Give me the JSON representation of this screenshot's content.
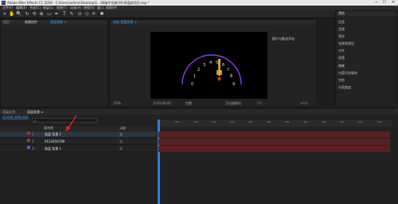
{
  "window": {
    "app_icon": "Ae",
    "title": "Adobe After Effects CC 2018 - C:\\Users\\admin\\Desktop\\1、AE破坏切换(四)\\表盘新项目.aep *",
    "minimize": "—",
    "maximize": "☐",
    "close": "✕"
  },
  "menu": [
    "文件(F)",
    "编辑(E)",
    "合成(C)",
    "图层(L)",
    "效果(T)",
    "动画(A)",
    "视图(V)",
    "窗口",
    "帮助(H)"
  ],
  "toolbar": {
    "tools": [
      "selection-arrow",
      "hand",
      "zoom",
      "rotate",
      "orbit-camera",
      "pan-behind",
      "rectangle-mask",
      "pen",
      "text",
      "brush",
      "clone-stamp",
      "eraser",
      "roto-brush",
      "puppet-pin"
    ],
    "glyphs": [
      "➤",
      "✋",
      "🔍",
      "↻",
      "⟲",
      "⊕",
      "▭",
      "✒",
      "T",
      "✎",
      "⊙",
      "◇",
      "✍",
      "✱"
    ]
  },
  "left_panel": {
    "tab_project": "项目",
    "tab_effects": "效果控件",
    "tab_layer": "表盘背景 ≡"
  },
  "comp_panel": {
    "tab": "合成 表盘背景 ≡",
    "tab_color": "#4aa3ff"
  },
  "viewer": {
    "numbers": [
      "0",
      "1",
      "2",
      "3",
      "4",
      "5",
      "6",
      "7",
      "8",
      "9"
    ],
    "arc_color": "#8c3cff",
    "needle_color": "#e6b23c",
    "label": "图片与推送开启"
  },
  "viewer_footer": {
    "zoom": "25%",
    "timecode": "0;00;00;00",
    "resolution": "完整",
    "camera": "活动摄像机",
    "views": "1个...",
    "exposure": "+0.0"
  },
  "right_panel": {
    "title": "预览",
    "items": [
      "信息",
      "音频",
      "预览",
      "效果和预设",
      "对齐",
      "段落"
    ],
    "lower_title": "效果",
    "sub_items": [
      "内容识别填充",
      "字符",
      "分离维度"
    ]
  },
  "timeline": {
    "tab_render": "渲染队列",
    "tab_comp": "表盘背景 ≡",
    "timecode": "0;00;00;00",
    "search_placeholder": "ρ",
    "columns": {
      "source_name": "源名称",
      "parent": "父级"
    },
    "ruler_ticks": [
      "0s",
      "05s",
      "10s",
      "15s",
      "20s",
      "25s",
      "30s",
      "35s",
      "40s",
      "45s",
      "50s",
      "55s",
      "1:00"
    ],
    "layers": [
      {
        "index": "1",
        "name": "表盘 背景 1",
        "parent": "无",
        "color": "#c0282a",
        "bar": "#5a1f20"
      },
      {
        "index": "2",
        "name": "0123456789",
        "parent": "无",
        "color": "#c0282a",
        "bar": "#5a1f20"
      },
      {
        "index": "3",
        "name": "表盘 背景 1",
        "parent": "无",
        "color": "#7a48d6",
        "bar": "#5a1f20"
      }
    ]
  }
}
